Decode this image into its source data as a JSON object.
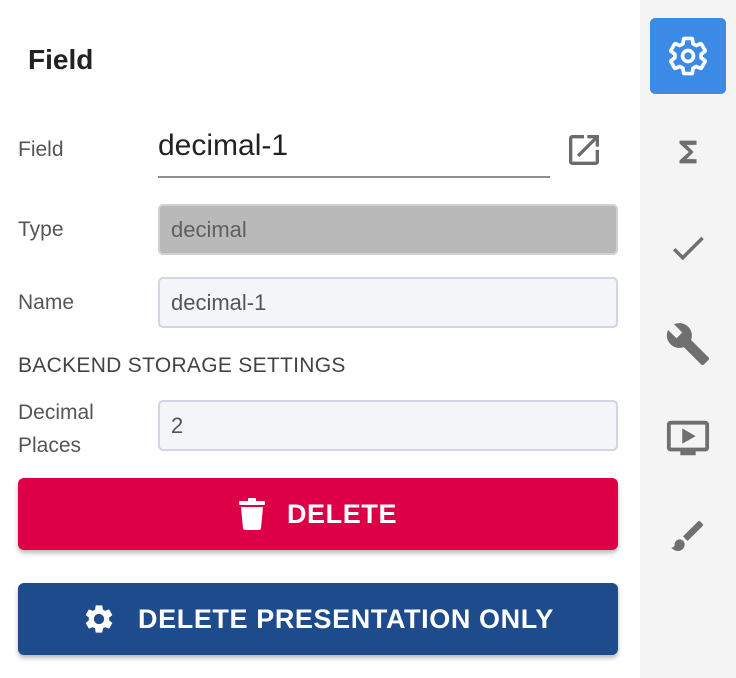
{
  "panel": {
    "title": "Field",
    "field_label": "Field",
    "field_value": "decimal-1",
    "type_label": "Type",
    "type_value": "decimal",
    "name_label": "Name",
    "name_value": "decimal-1",
    "section_header": "BACKEND STORAGE SETTINGS",
    "decimal_places_label": "Decimal Places",
    "decimal_places_value": "2",
    "delete_label": "DELETE",
    "delete_presentation_label": "DELETE PRESENTATION ONLY"
  },
  "toolbar": {
    "items": [
      {
        "icon": "gear-icon",
        "active": true
      },
      {
        "icon": "sigma-icon",
        "active": false
      },
      {
        "icon": "check-icon",
        "active": false
      },
      {
        "icon": "wrench-icon",
        "active": false
      },
      {
        "icon": "monitor-play-icon",
        "active": false
      },
      {
        "icon": "brush-icon",
        "active": false
      }
    ]
  },
  "colors": {
    "danger": "#de0047",
    "primary": "#1e4b8b",
    "active_tool": "#3b8be6",
    "toolbar_icon": "#6f6f6f"
  }
}
